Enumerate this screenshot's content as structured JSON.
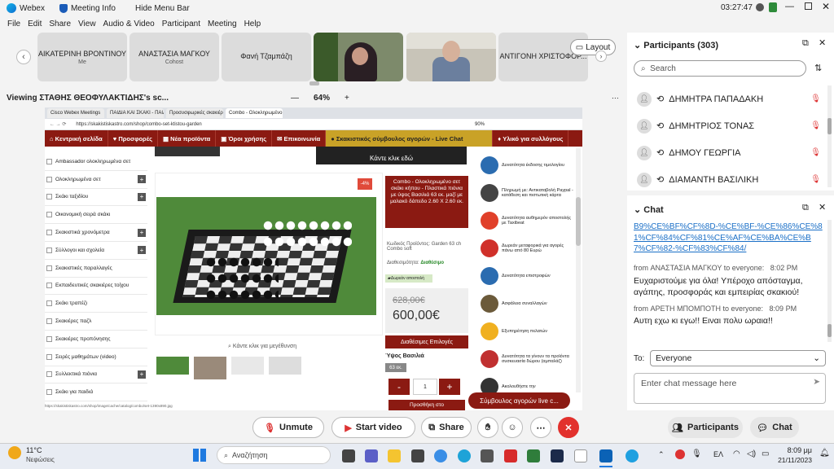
{
  "titlebar": {
    "app": "Webex",
    "meeting_info": "Meeting Info",
    "hide_menu": "Hide Menu Bar",
    "time": "03:27:47"
  },
  "menu": [
    "File",
    "Edit",
    "Share",
    "View",
    "Audio & Video",
    "Participant",
    "Meeting",
    "Help"
  ],
  "thumbs": [
    {
      "name": "ΑΙΚΑΤΕΡΙΝΗ ΒΡΟΝΤΙΝΟΥ",
      "sub": "Me"
    },
    {
      "name": "ΑΝΑΣΤΑΣΙΑ ΜΑΓΚΟΥ",
      "sub": "Cohost"
    },
    {
      "name": "Φανή Τζαμπάζη",
      "sub": ""
    },
    {
      "name": "ΑΝΤΙΓΟΝΗ ΧΡΙΣΤΟΦΟΡ...",
      "sub": ""
    }
  ],
  "layout_btn": "Layout",
  "share": {
    "viewing": "Viewing ΣΤΑΘΗΣ ΘΕΟΦΥΛΑΚΤΙΔΗΣ's sc...",
    "zoom": "64%",
    "minus": "—",
    "plus": "+"
  },
  "site": {
    "tabs": [
      "Cisco Webex Meetings",
      "ΠΑΙΔΙΑ ΚΑΙ ΣΚΑΚΙ - ΠΑΙΔΙ ΚΑΙ ΣΚΑΚΙ",
      "Προσυσφωρικές σκακιέρες σκάκι",
      "Combo - Ολοκληρωμένο σετ..."
    ],
    "url": "https://skakistiskastro.com/shop/combo-set-ktistou-garden",
    "zoom": "90%",
    "nav": [
      "Κεντρική σελίδα",
      "Προσφορές",
      "Νέα προϊόντα",
      "Όροι χρήσης",
      "Επικοινωνία",
      "Σκακιστικός σύμβουλος αγορών - Live Chat",
      "Υλικό για συλλόγους"
    ],
    "banner_text": "Κάντε κλικ εδώ",
    "categories": [
      "Ambassador ολοκληρωμένα σετ",
      "Ολοκληρωμένα σετ",
      "Σκάκι ταξιδίου",
      "Οικονομική σειρά σκάκι",
      "Σκακιστικά χρονόμετρα",
      "Σύλλογοι και σχολεία",
      "Σκακιστικές παραλλαγές",
      "Εκπαιδευτικές σκακιέρες τοίχου",
      "Σκάκι τραπέζι",
      "Σκακιέρες παζλ",
      "Σκακιέρες προπόνησης",
      "Σειρές μαθημάτων (video)",
      "Συλλεκτικά πιόνια",
      "Σκάκι για παιδιά"
    ],
    "cat_plus": [
      false,
      true,
      true,
      false,
      true,
      true,
      false,
      false,
      false,
      false,
      false,
      false,
      true,
      false
    ],
    "badge": "-4%",
    "enlarge": "Κάντε κλικ για μεγέθυνση",
    "product_title": "Combo - Ολοκληρωμένο σετ σκάκι κήπου - Πλαστικά πιόνια με ύψος Βασιλιά 63 εκ. μαζί με μαλακό δάπεδο 2.60 Χ 2.60 εκ.",
    "code": "Κωδικός Προϊόντος: Garden 63 ch Combo soft",
    "avail_label": "Διαθεσιμότητα:",
    "avail": "Διαθέσιμο",
    "free_ship": "Δωρεάν αποστολή",
    "old_price": "628,00€",
    "price": "600,00€",
    "options": "Διαθέσιμες Επιλογές",
    "king_height": "Ύψος Βασιλιά",
    "size": "63 εκ.",
    "qty": "1",
    "add": "Προσθήκη στο",
    "features": [
      "Δυνατότητα έκδοσης τιμολογίου",
      "Πληρωμή με: Αντικαταβολή Paypal - κατάθεση και πιστωτική κάρτα",
      "Δυνατότητα αυθημερόν αποστολής με Taxibeat",
      "Δωρεάν μεταφορικά για αγορές πάνω από 80 Ευρώ",
      "Δυνατότητα επιστροφών",
      "Ασφάλεια συναλλαγών",
      "Εξυπηρέτηση πελατών",
      "Δυνατότητα τα γίνουν τα προϊόντα συσκευασία δώρου (αμπαλάζ)",
      "Ακολουθήστε την"
    ],
    "live_chat": "Σύμβουλος αγορών live c...",
    "status_url": "https://skakistiskastro.com/shop/image/cache/catalog/combo/set-1390x890.jpg"
  },
  "controls": {
    "mute": "Unmute",
    "video": "Start video",
    "share": "Share",
    "participants": "Participants",
    "chat": "Chat"
  },
  "participants": {
    "title": "Participants (303)",
    "search_placeholder": "Search",
    "list": [
      "ΔΗΜΗΤΡΑ ΠΑΠΑΔΑΚΗ",
      "ΔΗΜΗΤΡΙΟΣ ΤΟΝΑΣ",
      "ΔΗΜΟΥ ΓΕΩΡΓΙΑ",
      "ΔΙΑΜΑΝΤΗ ΒΑΣΙΛΙΚΗ"
    ]
  },
  "chat": {
    "title": "Chat",
    "link": "B9%CE%BF%CF%8D-%CE%BF-%CE%86%CE%81%CF%84%CF%81%CE%AF%CE%BA%CE%B7%CF%82-%CF%83%CF%84/",
    "m1_from": "from ΑΝΑΣΤΑΣΙΑ ΜΑΓΚΟΥ to everyone:",
    "m1_time": "8:02 PM",
    "m1_text": "Ευχαριστούμε για όλα! Υπέροχο απόσταγμα, αγάπης, προσφοράς και εμπειρίας σκακιού!",
    "m2_from": "from ΑΡΕΤΗ ΜΠΟΜΠΟΤΗ to everyone:",
    "m2_time": "8:09 PM",
    "m2_text": "Αυτη εχω κι εγω!! Ειναι πολυ ωραια!!",
    "to_label": "To:",
    "to_value": "Everyone",
    "input_placeholder": "Enter chat message here"
  },
  "taskbar": {
    "temp": "11°C",
    "weather": "Νεφώσεις",
    "search": "Αναζήτηση",
    "lang": "ΕΛ",
    "time": "8:09 μμ",
    "date": "21/11/2023"
  }
}
